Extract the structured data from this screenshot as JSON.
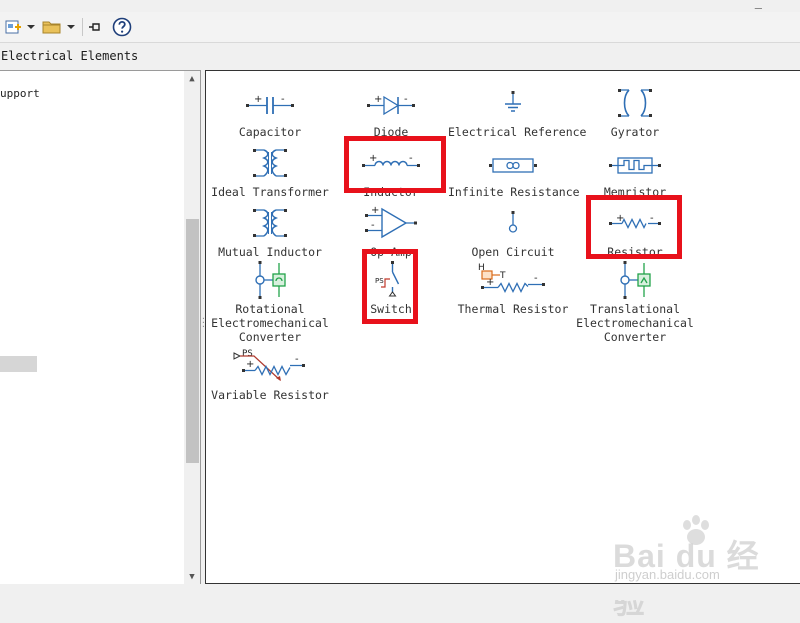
{
  "window": {
    "corner_glyph": "_"
  },
  "toolbar": {
    "buttons": [
      {
        "name": "new-model-button",
        "icon": "new-model-icon"
      },
      {
        "name": "new-dropdown-button",
        "icon": "chevron-down-icon"
      },
      {
        "name": "open-button",
        "icon": "folder-icon"
      },
      {
        "name": "open-dropdown-button",
        "icon": "chevron-down-icon"
      },
      {
        "name": "pin-button",
        "icon": "pin-icon"
      },
      {
        "name": "help-button",
        "icon": "help-icon"
      }
    ]
  },
  "breadcrumb": {
    "text": "Electrical Elements"
  },
  "left_pane": {
    "items": [
      {
        "label": "upport"
      }
    ]
  },
  "blocks": [
    {
      "label": "Capacitor",
      "icon": "capacitor-icon"
    },
    {
      "label": "Diode",
      "icon": "diode-icon"
    },
    {
      "label": "Electrical Reference",
      "icon": "ground-icon"
    },
    {
      "label": "Gyrator",
      "icon": "gyrator-icon"
    },
    {
      "label": "Ideal Transformer",
      "icon": "transformer-icon"
    },
    {
      "label": "Inductor",
      "icon": "inductor-icon",
      "highlighted": true
    },
    {
      "label": "Infinite Resistance",
      "icon": "infinite-resistance-icon"
    },
    {
      "label": "Memristor",
      "icon": "memristor-icon"
    },
    {
      "label": "Mutual Inductor",
      "icon": "mutual-inductor-icon"
    },
    {
      "label": "Op-Amp",
      "icon": "opamp-icon"
    },
    {
      "label": "Open Circuit",
      "icon": "open-circuit-icon"
    },
    {
      "label": "Resistor",
      "icon": "resistor-icon",
      "highlighted": true
    },
    {
      "label": [
        "Rotational",
        "Electromechanical",
        "Converter"
      ],
      "icon": "rotational-converter-icon"
    },
    {
      "label": "Switch",
      "icon": "switch-icon",
      "highlighted": true
    },
    {
      "label": "Thermal Resistor",
      "icon": "thermal-resistor-icon"
    },
    {
      "label": [
        "Translational",
        "Electromechanical",
        "Converter"
      ],
      "icon": "translational-converter-icon"
    },
    {
      "label": "Variable Resistor",
      "icon": "variable-resistor-icon"
    }
  ],
  "icon_text": {
    "plus": "+",
    "minus": "-",
    "thermal_h": "H",
    "thermal_t": "T",
    "variable_ps": "PS"
  },
  "watermark": {
    "brand": "Bai du 经验",
    "url": "jingyan.baidu.com"
  },
  "colors": {
    "highlight": "#e8111b",
    "icon_blue": "#2f6fb5",
    "icon_green": "#22a34a"
  }
}
